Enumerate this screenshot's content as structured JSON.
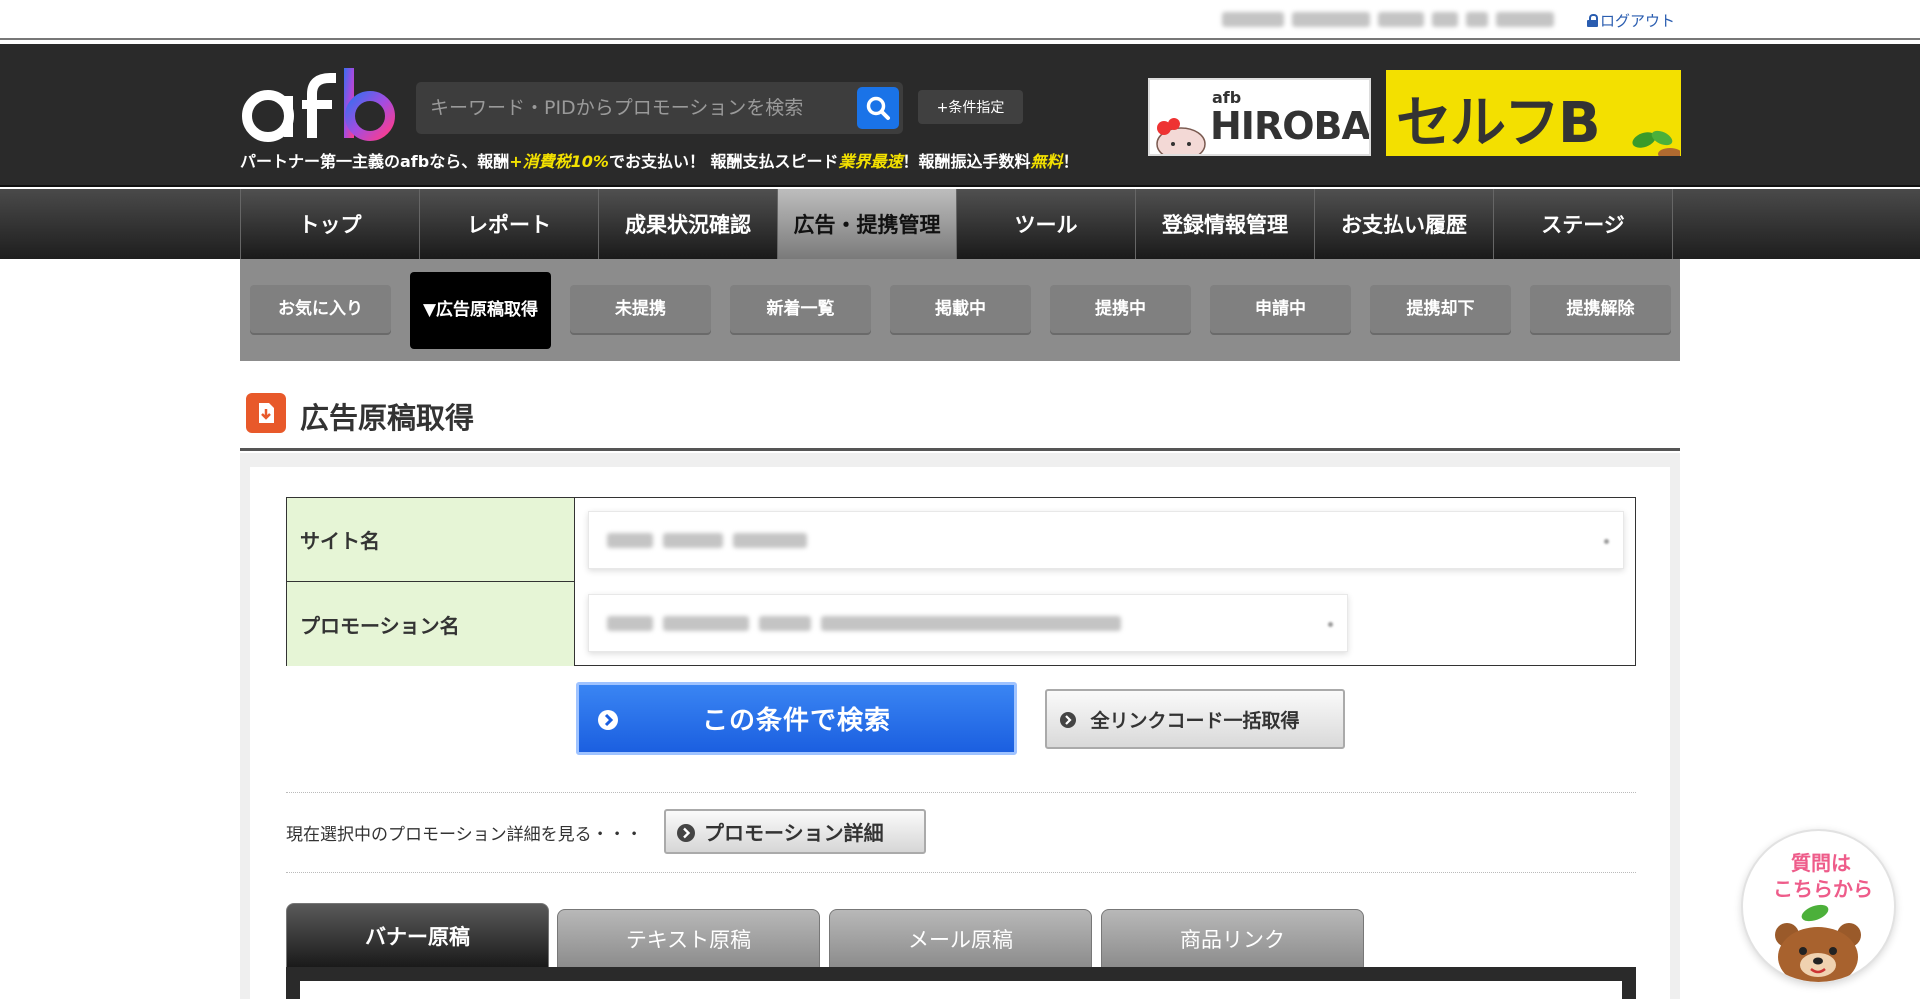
{
  "userbar": {
    "logout_label": "ログアウト"
  },
  "header": {
    "logo_alt": "afb",
    "search_placeholder": "キーワード・PIDからプロモーションを検索",
    "condition_button": "+条件指定",
    "tagline_parts": [
      "パートナー第一主義のafbなら、報酬",
      "+消費税10%",
      "でお支払い！ 報酬支払スピード",
      "業界最速",
      "！報酬振込手数料",
      "無料",
      "！"
    ],
    "banner_hiroba_small": "afb",
    "banner_hiroba": "HIROBA",
    "banner_selfb": "セルフB"
  },
  "main_nav": {
    "items": [
      "トップ",
      "レポート",
      "成果状況確認",
      "広告・提携管理",
      "ツール",
      "登録情報管理",
      "お支払い履歴",
      "ステージ"
    ],
    "active_index": 3
  },
  "sub_nav": {
    "items": [
      "お気に入り",
      "▼広告原稿取得",
      "未提携",
      "新着一覧",
      "掲載中",
      "提携中",
      "申請中",
      "提携却下",
      "提携解除"
    ],
    "active_index": 1
  },
  "page": {
    "title": "広告原稿取得"
  },
  "form": {
    "site_label": "サイト名",
    "promotion_label": "プロモーション名"
  },
  "buttons": {
    "search": "この条件で検索",
    "all_links": "全リンクコード一括取得",
    "promo_detail": "プロモーション詳細"
  },
  "promo_text": "現在選択中のプロモーション詳細を見る・・・",
  "tabs": {
    "items": [
      "バナー原稿",
      "テキスト原稿",
      "メール原稿",
      "商品リンク"
    ],
    "active_index": 0
  },
  "help": {
    "line1": "質問は",
    "line2": "こちらから"
  },
  "colors": {
    "header_bg": "#2a2a2a",
    "accent_blue": "#1b5fe0",
    "tagline_highlight": "#f3e100",
    "form_label_bg": "#e6f5d6",
    "banner_yellow": "#f3e000",
    "help_pink": "#ee5c8a"
  }
}
